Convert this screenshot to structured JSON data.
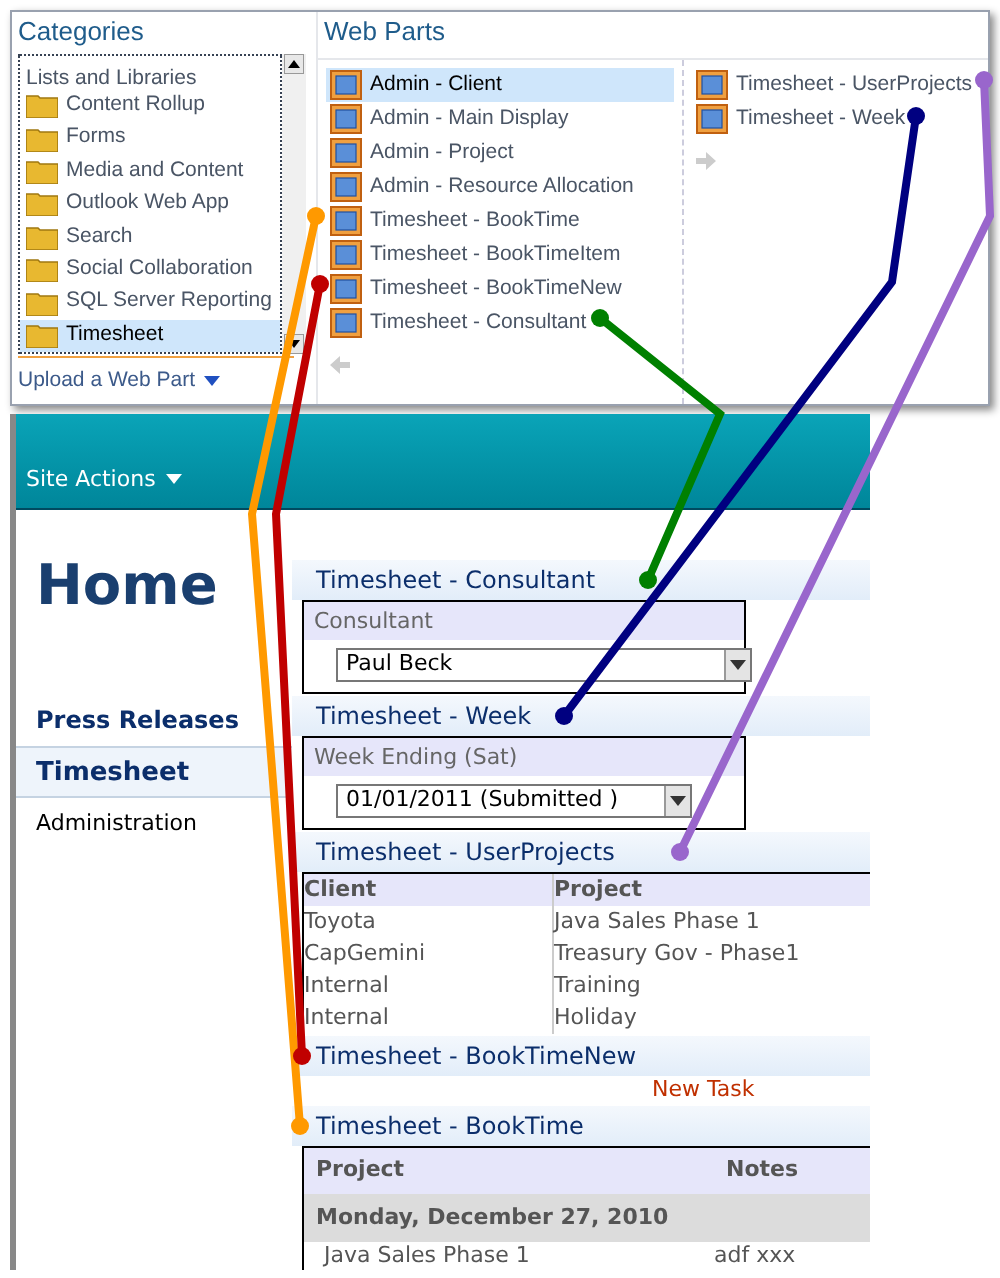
{
  "categories": {
    "title": "Categories",
    "items": [
      {
        "label": "Lists and Libraries",
        "selected": false
      },
      {
        "label": "Content Rollup",
        "selected": false
      },
      {
        "label": "Forms",
        "selected": false
      },
      {
        "label": "Media and Content",
        "selected": false
      },
      {
        "label": "Outlook Web App",
        "selected": false
      },
      {
        "label": "Search",
        "selected": false
      },
      {
        "label": "Social Collaboration",
        "selected": false
      },
      {
        "label": "SQL Server Reporting",
        "selected": false
      },
      {
        "label": "Timesheet",
        "selected": true
      }
    ],
    "upload_link": "Upload a Web Part"
  },
  "web_parts": {
    "title": "Web Parts",
    "columns": [
      {
        "items": [
          {
            "label": "Admin - Client",
            "selected": true
          },
          {
            "label": "Admin - Main Display",
            "selected": false
          },
          {
            "label": "Admin - Project",
            "selected": false
          },
          {
            "label": "Admin - Resource Allocation",
            "selected": false
          },
          {
            "label": "Timesheet - BookTime",
            "selected": false
          },
          {
            "label": "Timesheet - BookTimeItem",
            "selected": false
          },
          {
            "label": "Timesheet - BookTimeNew",
            "selected": false
          },
          {
            "label": "Timesheet - Consultant",
            "selected": false
          }
        ]
      },
      {
        "items": [
          {
            "label": "Timesheet - UserProjects",
            "selected": false
          },
          {
            "label": "Timesheet - Week",
            "selected": false
          }
        ]
      }
    ]
  },
  "site": {
    "site_actions": "Site Actions",
    "page_title": "Home",
    "nav": [
      {
        "label": "Press Releases",
        "kind": "heading",
        "selected": false
      },
      {
        "label": "Timesheet",
        "kind": "heading",
        "selected": true
      },
      {
        "label": "Administration",
        "kind": "link",
        "selected": false
      }
    ],
    "zones": [
      {
        "kind": "dropdown",
        "title": "Timesheet - Consultant",
        "label": "Consultant",
        "value": "Paul Beck"
      },
      {
        "kind": "dropdown",
        "title": "Timesheet - Week",
        "label": "Week Ending (Sat)",
        "value": "01/01/2011 (Submitted )"
      },
      {
        "kind": "table",
        "title": "Timesheet - UserProjects",
        "columns": [
          "Client",
          "Project"
        ],
        "rows": [
          [
            "Toyota",
            "Java Sales Phase 1"
          ],
          [
            "CapGemini",
            "Treasury Gov - Phase1"
          ],
          [
            "Internal",
            "Training"
          ],
          [
            "Internal",
            "Holiday"
          ]
        ]
      },
      {
        "kind": "link",
        "title": "Timesheet - BookTimeNew",
        "link": "New Task"
      },
      {
        "kind": "grid",
        "title": "Timesheet - BookTime",
        "columns": [
          "Project",
          "Notes"
        ],
        "group": "Monday, December 27, 2010",
        "rows": [
          [
            "Java Sales Phase 1",
            "adf xxx"
          ]
        ]
      }
    ]
  },
  "annotations": [
    {
      "color": "#ff9900"
    },
    {
      "color": "#c00000"
    },
    {
      "color": "#008000"
    },
    {
      "color": "#000080"
    },
    {
      "color": "#9966cc"
    }
  ]
}
